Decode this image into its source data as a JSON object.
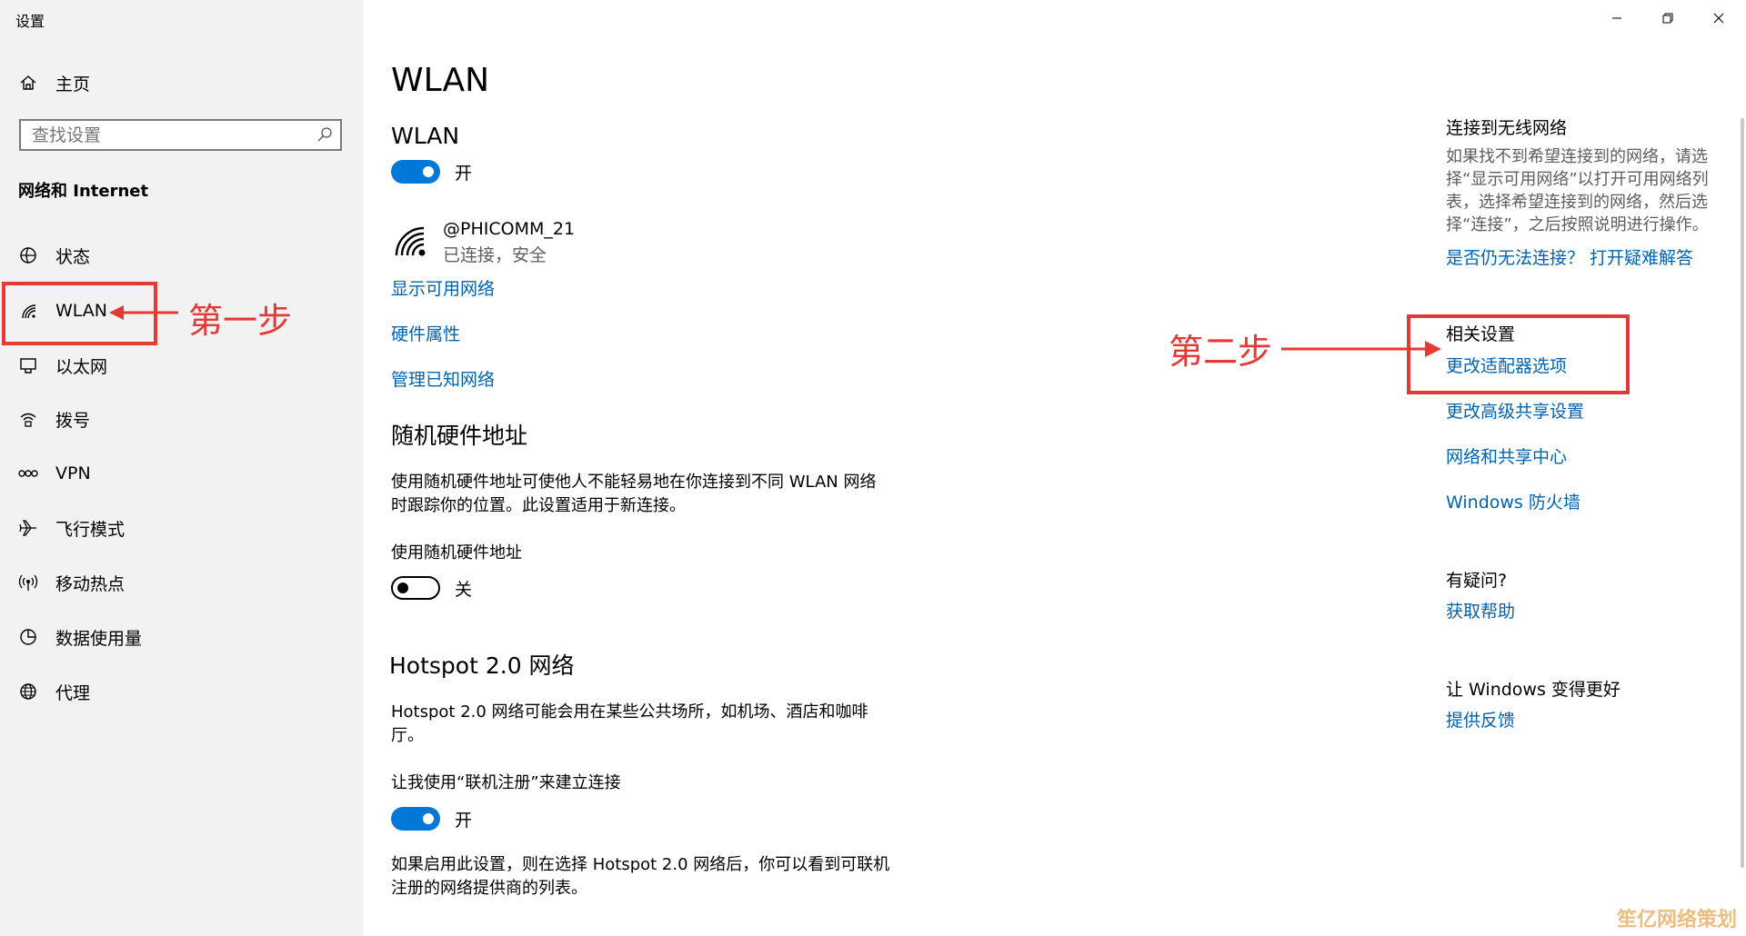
{
  "window": {
    "title": "设置",
    "controls": [
      "minimize-icon",
      "restore-icon",
      "close-icon"
    ]
  },
  "sidebar": {
    "home_label": "主页",
    "search_placeholder": "查找设置",
    "section_title": "网络和 Internet",
    "items": [
      {
        "label": "状态",
        "icon": "status-icon"
      },
      {
        "label": "WLAN",
        "icon": "wifi-icon",
        "selected": true
      },
      {
        "label": "以太网",
        "icon": "ethernet-icon"
      },
      {
        "label": "拨号",
        "icon": "dialup-icon"
      },
      {
        "label": "VPN",
        "icon": "vpn-icon"
      },
      {
        "label": "飞行模式",
        "icon": "airplane-icon"
      },
      {
        "label": "移动热点",
        "icon": "hotspot-icon"
      },
      {
        "label": "数据使用量",
        "icon": "data-usage-icon"
      },
      {
        "label": "代理",
        "icon": "globe-icon"
      }
    ]
  },
  "main": {
    "title": "WLAN",
    "wlan_heading": "WLAN",
    "wlan_toggle": {
      "state": "on",
      "label": "开"
    },
    "network": {
      "name": "@PHICOMM_21",
      "status": "已连接，安全"
    },
    "links": [
      "显示可用网络",
      "硬件属性",
      "管理已知网络"
    ],
    "random_mac": {
      "heading": "随机硬件地址",
      "description_line1": "使用随机硬件地址可使他人不能轻易地在你连接到不同 WLAN 网络",
      "description_line2": "时跟踪你的位置。此设置适用于新连接。",
      "toggle_caption": "使用随机硬件地址",
      "toggle": {
        "state": "off",
        "label": "关"
      }
    },
    "hotspot": {
      "heading": "Hotspot 2.0 网络",
      "description_line1": "Hotspot 2.0 网络可能会用在某些公共场所，如机场、酒店和咖啡",
      "description_line2": "厅。",
      "toggle_caption": "让我使用“联机注册”来建立连接",
      "toggle": {
        "state": "on",
        "label": "开"
      },
      "footer_line1": "如果启用此设置，则在选择 Hotspot 2.0 网络后，你可以看到可联机",
      "footer_line2": "注册的网络提供商的列表。"
    }
  },
  "right": {
    "connect": {
      "heading": "连接到无线网络",
      "body_line1": "如果找不到希望连接到的网络，请选",
      "body_line2": "择“显示可用网络”以打开可用网络列",
      "body_line3": "表，选择希望连接到的网络，然后选",
      "body_line4": "择“连接”，之后按照说明进行操作。",
      "link": "是否仍无法连接？ 打开疑难解答"
    },
    "related": {
      "heading": "相关设置",
      "links": [
        "更改适配器选项",
        "更改高级共享设置",
        "网络和共享中心",
        "Windows 防火墙"
      ]
    },
    "help": {
      "heading": "有疑问?",
      "link": "获取帮助"
    },
    "feedback": {
      "heading": "让 Windows 变得更好",
      "link": "提供反馈"
    }
  },
  "annotations": {
    "step1": "第一步",
    "step2": "第二步",
    "color": "#e53935"
  },
  "watermark": "笙亿网络策划",
  "colors": {
    "accent": "#0078d7",
    "link": "#0063b1",
    "sidebar_bg": "#f2f2f2"
  }
}
